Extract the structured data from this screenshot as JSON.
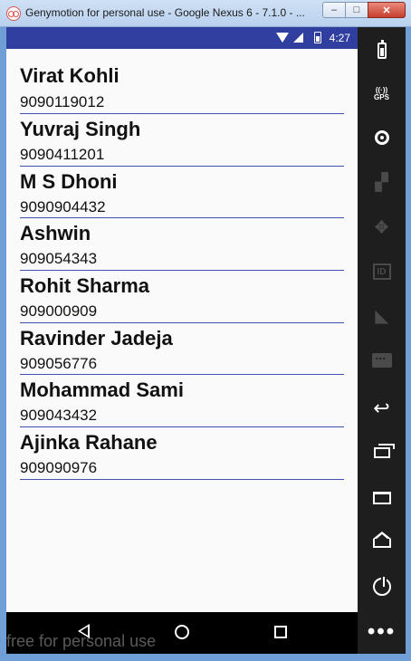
{
  "window": {
    "title": "Genymotion for personal use - Google Nexus 6 - 7.1.0 - ...",
    "minimize": "–",
    "maximize": "□",
    "close": "✕"
  },
  "status_bar": {
    "time": "4:27",
    "icons": [
      "wifi-icon",
      "signal-icon",
      "battery-icon"
    ]
  },
  "contacts": [
    {
      "name": "Virat Kohli",
      "phone": "9090119012"
    },
    {
      "name": "Yuvraj Singh",
      "phone": "9090411201"
    },
    {
      "name": "M S Dhoni",
      "phone": "9090904432"
    },
    {
      "name": "Ashwin",
      "phone": "909054343"
    },
    {
      "name": "Rohit Sharma",
      "phone": "909000909"
    },
    {
      "name": "Ravinder Jadeja",
      "phone": "909056776"
    },
    {
      "name": "Mohammad Sami",
      "phone": "909043432"
    },
    {
      "name": "Ajinka Rahane",
      "phone": "909090976"
    }
  ],
  "nav_bar": {
    "watermark": "free for personal use"
  },
  "sidebar": {
    "gps_label": "GPS",
    "id_label": "ID",
    "tools": [
      "battery-icon",
      "gps-icon",
      "camera-icon",
      "capture-icon",
      "dpad-icon",
      "identifier-icon",
      "cast-icon",
      "sms-icon",
      "back-icon",
      "recent-apps-icon",
      "menu-icon",
      "home-icon",
      "power-icon",
      "more-icon"
    ]
  },
  "colors": {
    "status_bar": "#303f9f",
    "divider": "#3f51b5",
    "sidebar": "#1e1e1e",
    "window_frame": "#6f9fd6"
  }
}
